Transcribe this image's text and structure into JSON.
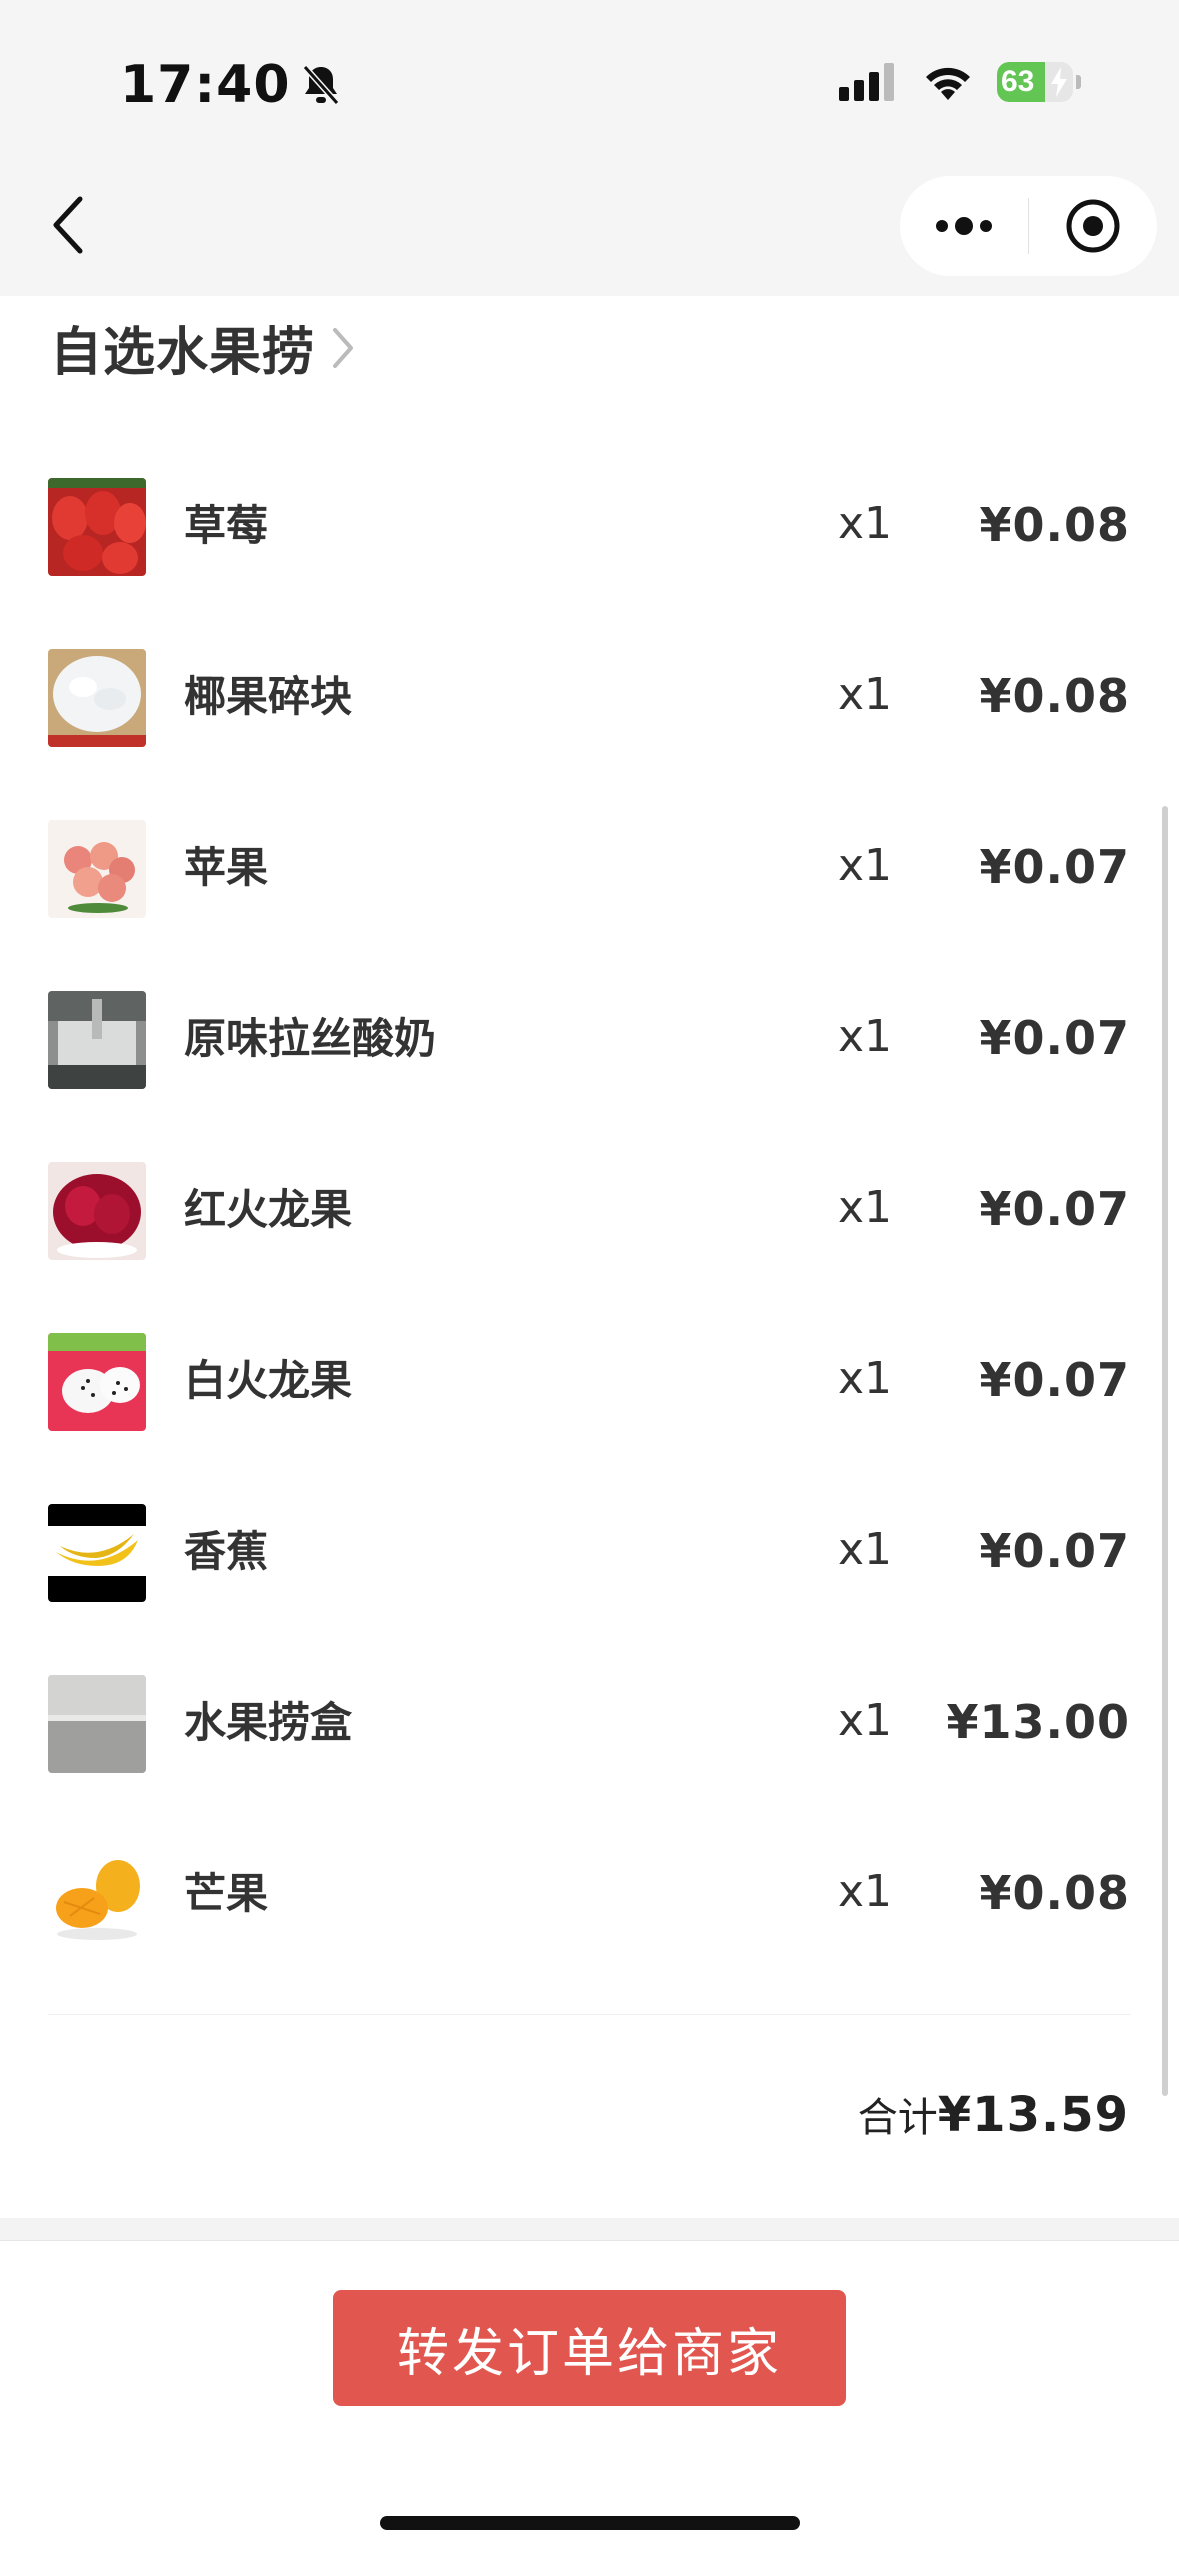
{
  "status_bar": {
    "time": "17:40",
    "battery": "63",
    "battery_fraction": 0.63
  },
  "nav": {
    "more_icon": "ellipsis-icon",
    "close_icon": "target-circle-icon"
  },
  "store": {
    "name": "自选水果捞"
  },
  "items": [
    {
      "name": "草莓",
      "qty": "x1",
      "price": "¥0.08",
      "icon": "strawberry"
    },
    {
      "name": "椰果碎块",
      "qty": "x1",
      "price": "¥0.08",
      "icon": "coconut-jelly"
    },
    {
      "name": "苹果",
      "qty": "x1",
      "price": "¥0.07",
      "icon": "apple"
    },
    {
      "name": "原味拉丝酸奶",
      "qty": "x1",
      "price": "¥0.07",
      "icon": "yogurt"
    },
    {
      "name": "红火龙果",
      "qty": "x1",
      "price": "¥0.07",
      "icon": "red-dragon-fruit"
    },
    {
      "name": "白火龙果",
      "qty": "x1",
      "price": "¥0.07",
      "icon": "white-dragon-fruit"
    },
    {
      "name": "香蕉",
      "qty": "x1",
      "price": "¥0.07",
      "icon": "banana"
    },
    {
      "name": "水果捞盒",
      "qty": "x1",
      "price": "¥13.00",
      "icon": "fruit-box"
    },
    {
      "name": "芒果",
      "qty": "x1",
      "price": "¥0.08",
      "icon": "mango"
    }
  ],
  "summary": {
    "label": "合计",
    "amount": "¥13.59"
  },
  "actions": {
    "forward_label": "转发订单给商家"
  },
  "colors": {
    "accent": "#e1574f",
    "battery": "#62c554"
  }
}
